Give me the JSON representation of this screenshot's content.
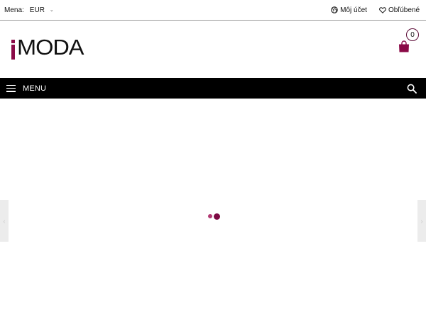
{
  "topbar": {
    "currency_label": "Mena:",
    "currency_value": "EUR",
    "account_label": "Môj účet",
    "favorites_label": "Obľúbené"
  },
  "header": {
    "logo_text": "MODA",
    "cart_count": "0"
  },
  "nav": {
    "menu_label": "MENU"
  },
  "icons": {
    "account": "globe-icon",
    "favorites": "heart-icon",
    "cart": "shopping-bag-icon",
    "menu": "hamburger-icon",
    "search": "search-icon"
  },
  "colors": {
    "brand": "#8a0a47",
    "navbar": "#000000",
    "loader_dot_light": "#b23a73",
    "loader_dot_dark": "#7d0a43"
  }
}
